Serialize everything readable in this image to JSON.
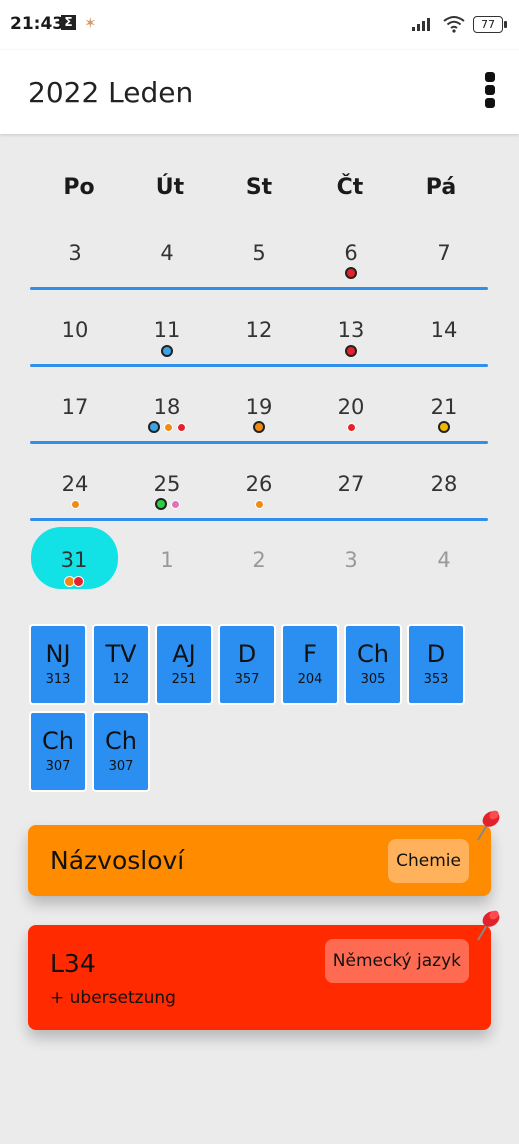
{
  "status_bar": {
    "time": "21:43",
    "notif_sigma": "Σ",
    "battery": "77"
  },
  "app_bar": {
    "title": "2022 Leden"
  },
  "calendar": {
    "weekdays": [
      "Po",
      "Út",
      "St",
      "Čt",
      "Pá"
    ],
    "weeks": [
      [
        "3",
        "4",
        "5",
        "6",
        "7"
      ],
      [
        "10",
        "11",
        "12",
        "13",
        "14"
      ],
      [
        "17",
        "18",
        "19",
        "20",
        "21"
      ],
      [
        "24",
        "25",
        "26",
        "27",
        "28"
      ],
      [
        "31",
        "1",
        "2",
        "3",
        "4"
      ]
    ],
    "selected_day": "31",
    "event_colors": {
      "red": "#e3222a",
      "blue": "#3ba4e4",
      "orange": "#ef8a12",
      "yellow": "#f2b705",
      "green": "#2ecc40",
      "pink": "#e76fb8",
      "today": "#12e2e6"
    }
  },
  "lessons": [
    {
      "abbr": "NJ",
      "room": "313"
    },
    {
      "abbr": "TV",
      "room": "12"
    },
    {
      "abbr": "AJ",
      "room": "251"
    },
    {
      "abbr": "D",
      "room": "357"
    },
    {
      "abbr": "F",
      "room": "204"
    },
    {
      "abbr": "Ch",
      "room": "305"
    },
    {
      "abbr": "D",
      "room": "353"
    },
    {
      "abbr": "Ch",
      "room": "307"
    },
    {
      "abbr": "Ch",
      "room": "307"
    }
  ],
  "tasks": [
    {
      "title": "Názvosloví",
      "subject": "Chemie",
      "subtitle": "",
      "color": "#ff8c00"
    },
    {
      "title": "L34",
      "subject": "Německý jazyk",
      "subtitle": "+ ubersetzung",
      "color": "#ff2a00"
    }
  ]
}
